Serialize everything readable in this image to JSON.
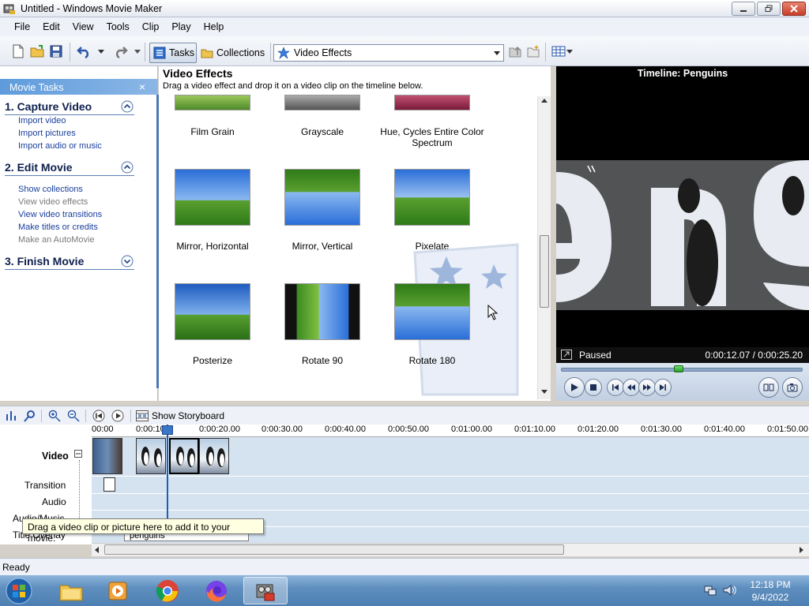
{
  "window": {
    "title": "Untitled - Windows Movie Maker"
  },
  "menu": [
    "File",
    "Edit",
    "View",
    "Tools",
    "Clip",
    "Play",
    "Help"
  ],
  "toolbar": {
    "tasks_label": "Tasks",
    "collections_label": "Collections",
    "collection_selected": "Video Effects"
  },
  "taskpane": {
    "header": "Movie Tasks",
    "close_glyph": "×",
    "sections": [
      {
        "title": "1. Capture Video",
        "links": [
          {
            "label": "Import video",
            "enabled": true
          },
          {
            "label": "Import pictures",
            "enabled": true
          },
          {
            "label": "Import audio or music",
            "enabled": true
          }
        ]
      },
      {
        "title": "2. Edit Movie",
        "links": [
          {
            "label": "Show collections",
            "enabled": true
          },
          {
            "label": "View video effects",
            "enabled": false
          },
          {
            "label": "View video transitions",
            "enabled": true
          },
          {
            "label": "Make titles or credits",
            "enabled": true
          },
          {
            "label": "Make an AutoMovie",
            "enabled": false
          }
        ]
      },
      {
        "title": "3. Finish Movie",
        "links": []
      }
    ]
  },
  "effects": {
    "title": "Video Effects",
    "hint": "Drag a video effect and drop it on a video clip on the timeline below.",
    "items": [
      {
        "label": "Film Grain"
      },
      {
        "label": "Grayscale"
      },
      {
        "label": "Hue, Cycles Entire Color Spectrum"
      },
      {
        "label": "Mirror, Horizontal"
      },
      {
        "label": "Mirror, Vertical"
      },
      {
        "label": "Pixelate"
      },
      {
        "label": "Posterize"
      },
      {
        "label": "Rotate 90"
      },
      {
        "label": "Rotate 180"
      }
    ]
  },
  "preview": {
    "title": "Timeline: Penguins",
    "status": "Paused",
    "time": "0:00:12.07 / 0:00:25.20",
    "progress": 0.478
  },
  "timeline": {
    "show_storyboard": "Show Storyboard",
    "ruler": [
      "00:00",
      "0:00:10",
      "0:00:20.00",
      "0:00:30.00",
      "0:00:40.00",
      "0:00:50.00",
      "0:01:00.00",
      "0:01:10.00",
      "0:01:20.00",
      "0:01:30.00",
      "0:01:40.00",
      "0:01:50.00"
    ],
    "tracks": [
      "Video",
      "Transition",
      "Audio",
      "Audio/Music",
      "Title Overlay"
    ],
    "title_overlay_text": "penguins",
    "tooltip": "Drag a video clip or picture here to add it to your movie."
  },
  "statusbar": {
    "text": "Ready"
  },
  "taskbar": {
    "time": "12:18 PM",
    "date": "9/4/2022"
  }
}
